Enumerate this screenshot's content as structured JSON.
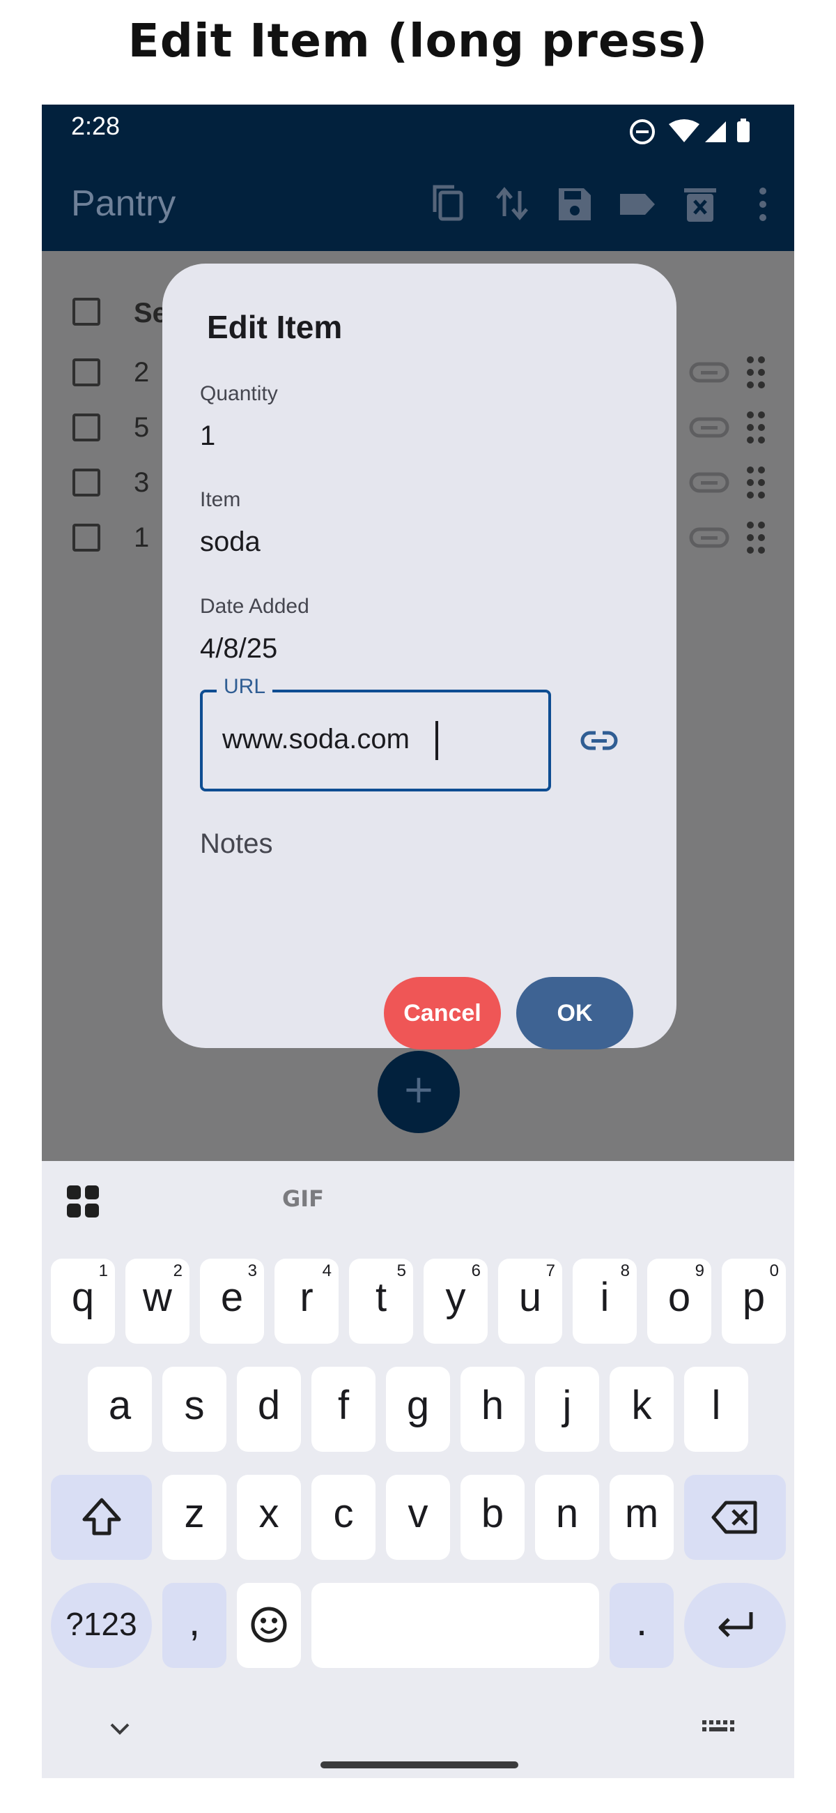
{
  "caption": "Edit Item (long press)",
  "status_bar": {
    "time": "2:28"
  },
  "app_bar": {
    "title": "Pantry"
  },
  "list": {
    "header": "Se",
    "rows": [
      {
        "text": "2 "
      },
      {
        "text": "5 "
      },
      {
        "text": "3 "
      },
      {
        "text": "1 "
      }
    ]
  },
  "dialog": {
    "title": "Edit Item",
    "fields": {
      "quantity": {
        "label": "Quantity",
        "value": "1"
      },
      "item": {
        "label": "Item",
        "value": "soda"
      },
      "date_added": {
        "label": "Date Added",
        "value": "4/8/25"
      },
      "url": {
        "label": "URL",
        "value": "www.soda.com"
      },
      "notes": {
        "placeholder": "Notes"
      }
    },
    "cancel_label": "Cancel",
    "ok_label": "OK"
  },
  "fab": {
    "label": "+"
  },
  "keyboard": {
    "toolbar": {
      "gif": "GIF"
    },
    "row1": [
      {
        "key": "q",
        "hint": "1"
      },
      {
        "key": "w",
        "hint": "2"
      },
      {
        "key": "e",
        "hint": "3"
      },
      {
        "key": "r",
        "hint": "4"
      },
      {
        "key": "t",
        "hint": "5"
      },
      {
        "key": "y",
        "hint": "6"
      },
      {
        "key": "u",
        "hint": "7"
      },
      {
        "key": "i",
        "hint": "8"
      },
      {
        "key": "o",
        "hint": "9"
      },
      {
        "key": "p",
        "hint": "0"
      }
    ],
    "row2": [
      "a",
      "s",
      "d",
      "f",
      "g",
      "h",
      "j",
      "k",
      "l"
    ],
    "row3": [
      "z",
      "x",
      "c",
      "v",
      "b",
      "n",
      "m"
    ],
    "symbols": "?123",
    "comma": ",",
    "period": "."
  },
  "colors": {
    "app_bar": "#02213d",
    "dialog_bg": "#e5e6ee",
    "cancel": "#ef5656",
    "ok": "#3e6393",
    "accent": "#0e4d92"
  }
}
